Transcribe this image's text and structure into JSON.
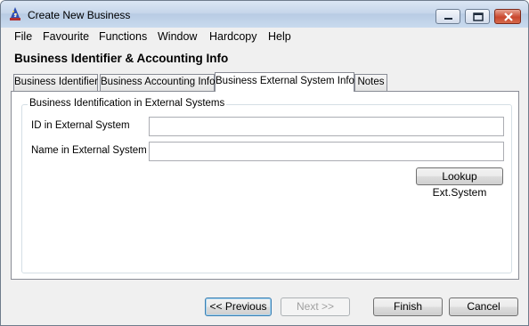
{
  "window": {
    "title": "Create New Business",
    "icon": "wizard-app-icon",
    "controls": [
      "minimize-icon",
      "maximize-icon",
      "close-icon"
    ]
  },
  "menu": [
    "File",
    "Favourite",
    "Functions",
    "Window",
    "Hardcopy",
    "Help"
  ],
  "section_title": "Business Identifier & Accounting Info",
  "tabs": [
    {
      "label": "Business Identifier",
      "active": false
    },
    {
      "label": "Business Accounting Info",
      "active": false
    },
    {
      "label": "Business External System Info",
      "active": true
    },
    {
      "label": "Notes",
      "active": false
    }
  ],
  "group": {
    "label": "Business Identification in External Systems",
    "fields": [
      {
        "label": "ID in External System",
        "value": ""
      },
      {
        "label": "Name in External System",
        "value": ""
      }
    ],
    "lookup_button": "Lookup Ext.System"
  },
  "footer": {
    "previous": "<< Previous",
    "next": "Next >>",
    "finish": "Finish",
    "cancel": "Cancel"
  },
  "colors": {
    "titlebar": "#c6d6ea",
    "close_button": "#c9472f",
    "focus_border": "#3c7fb1"
  }
}
